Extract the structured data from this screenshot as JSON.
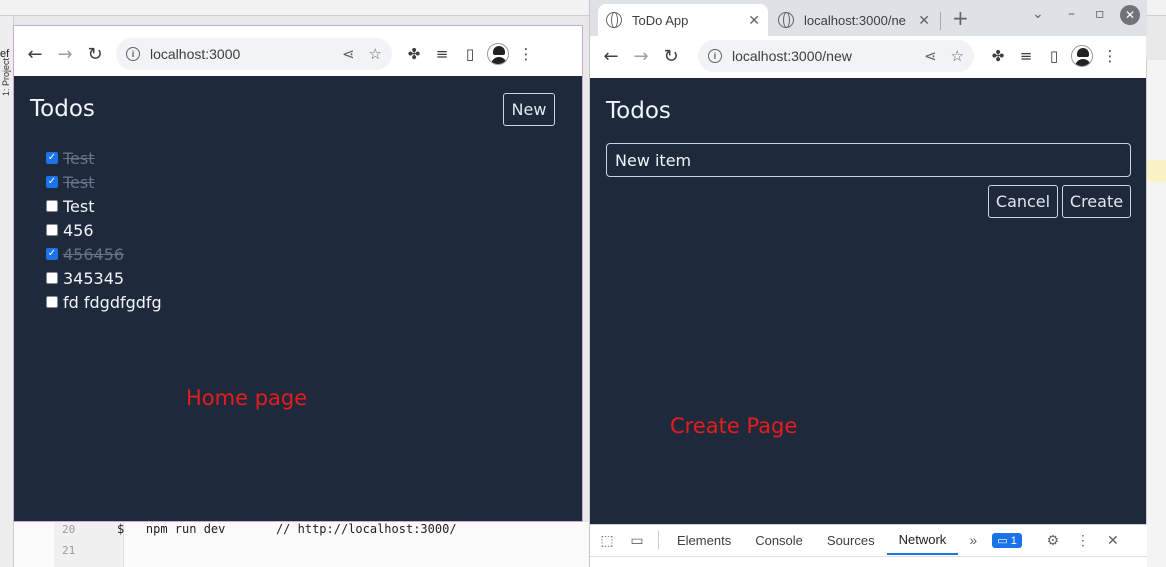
{
  "ide": {
    "sidebar_label": "1: Project",
    "lines": [
      {
        "num": "20",
        "code": "$   npm run dev       // http://localhost:3000/"
      },
      {
        "num": "21",
        "code": ""
      }
    ]
  },
  "left_browser": {
    "url": "localhost:3000",
    "app": {
      "title": "Todos",
      "new_button": "New",
      "todos": [
        {
          "text": "Test",
          "done": true
        },
        {
          "text": "Test",
          "done": true
        },
        {
          "text": "Test",
          "done": false
        },
        {
          "text": "456",
          "done": false
        },
        {
          "text": "456456",
          "done": true
        },
        {
          "text": "345345",
          "done": false
        },
        {
          "text": "fd fdgdfgdfg",
          "done": false
        }
      ],
      "annotation": "Home page"
    }
  },
  "right_browser": {
    "tabs": [
      {
        "title": "ToDo App",
        "active": true
      },
      {
        "title": "localhost:3000/ne",
        "active": false
      }
    ],
    "url": "localhost:3000/new",
    "app": {
      "title": "Todos",
      "input_value": "New item",
      "cancel_button": "Cancel",
      "create_button": "Create",
      "annotation": "Create Page"
    },
    "devtools": {
      "tabs": [
        "Elements",
        "Console",
        "Sources",
        "Network"
      ],
      "active_tab": "Network",
      "issues_count": "1"
    }
  },
  "colors": {
    "app_background": "#1e293b",
    "annotation": "#e81c1c",
    "checkbox_checked": "#1a73e8"
  }
}
